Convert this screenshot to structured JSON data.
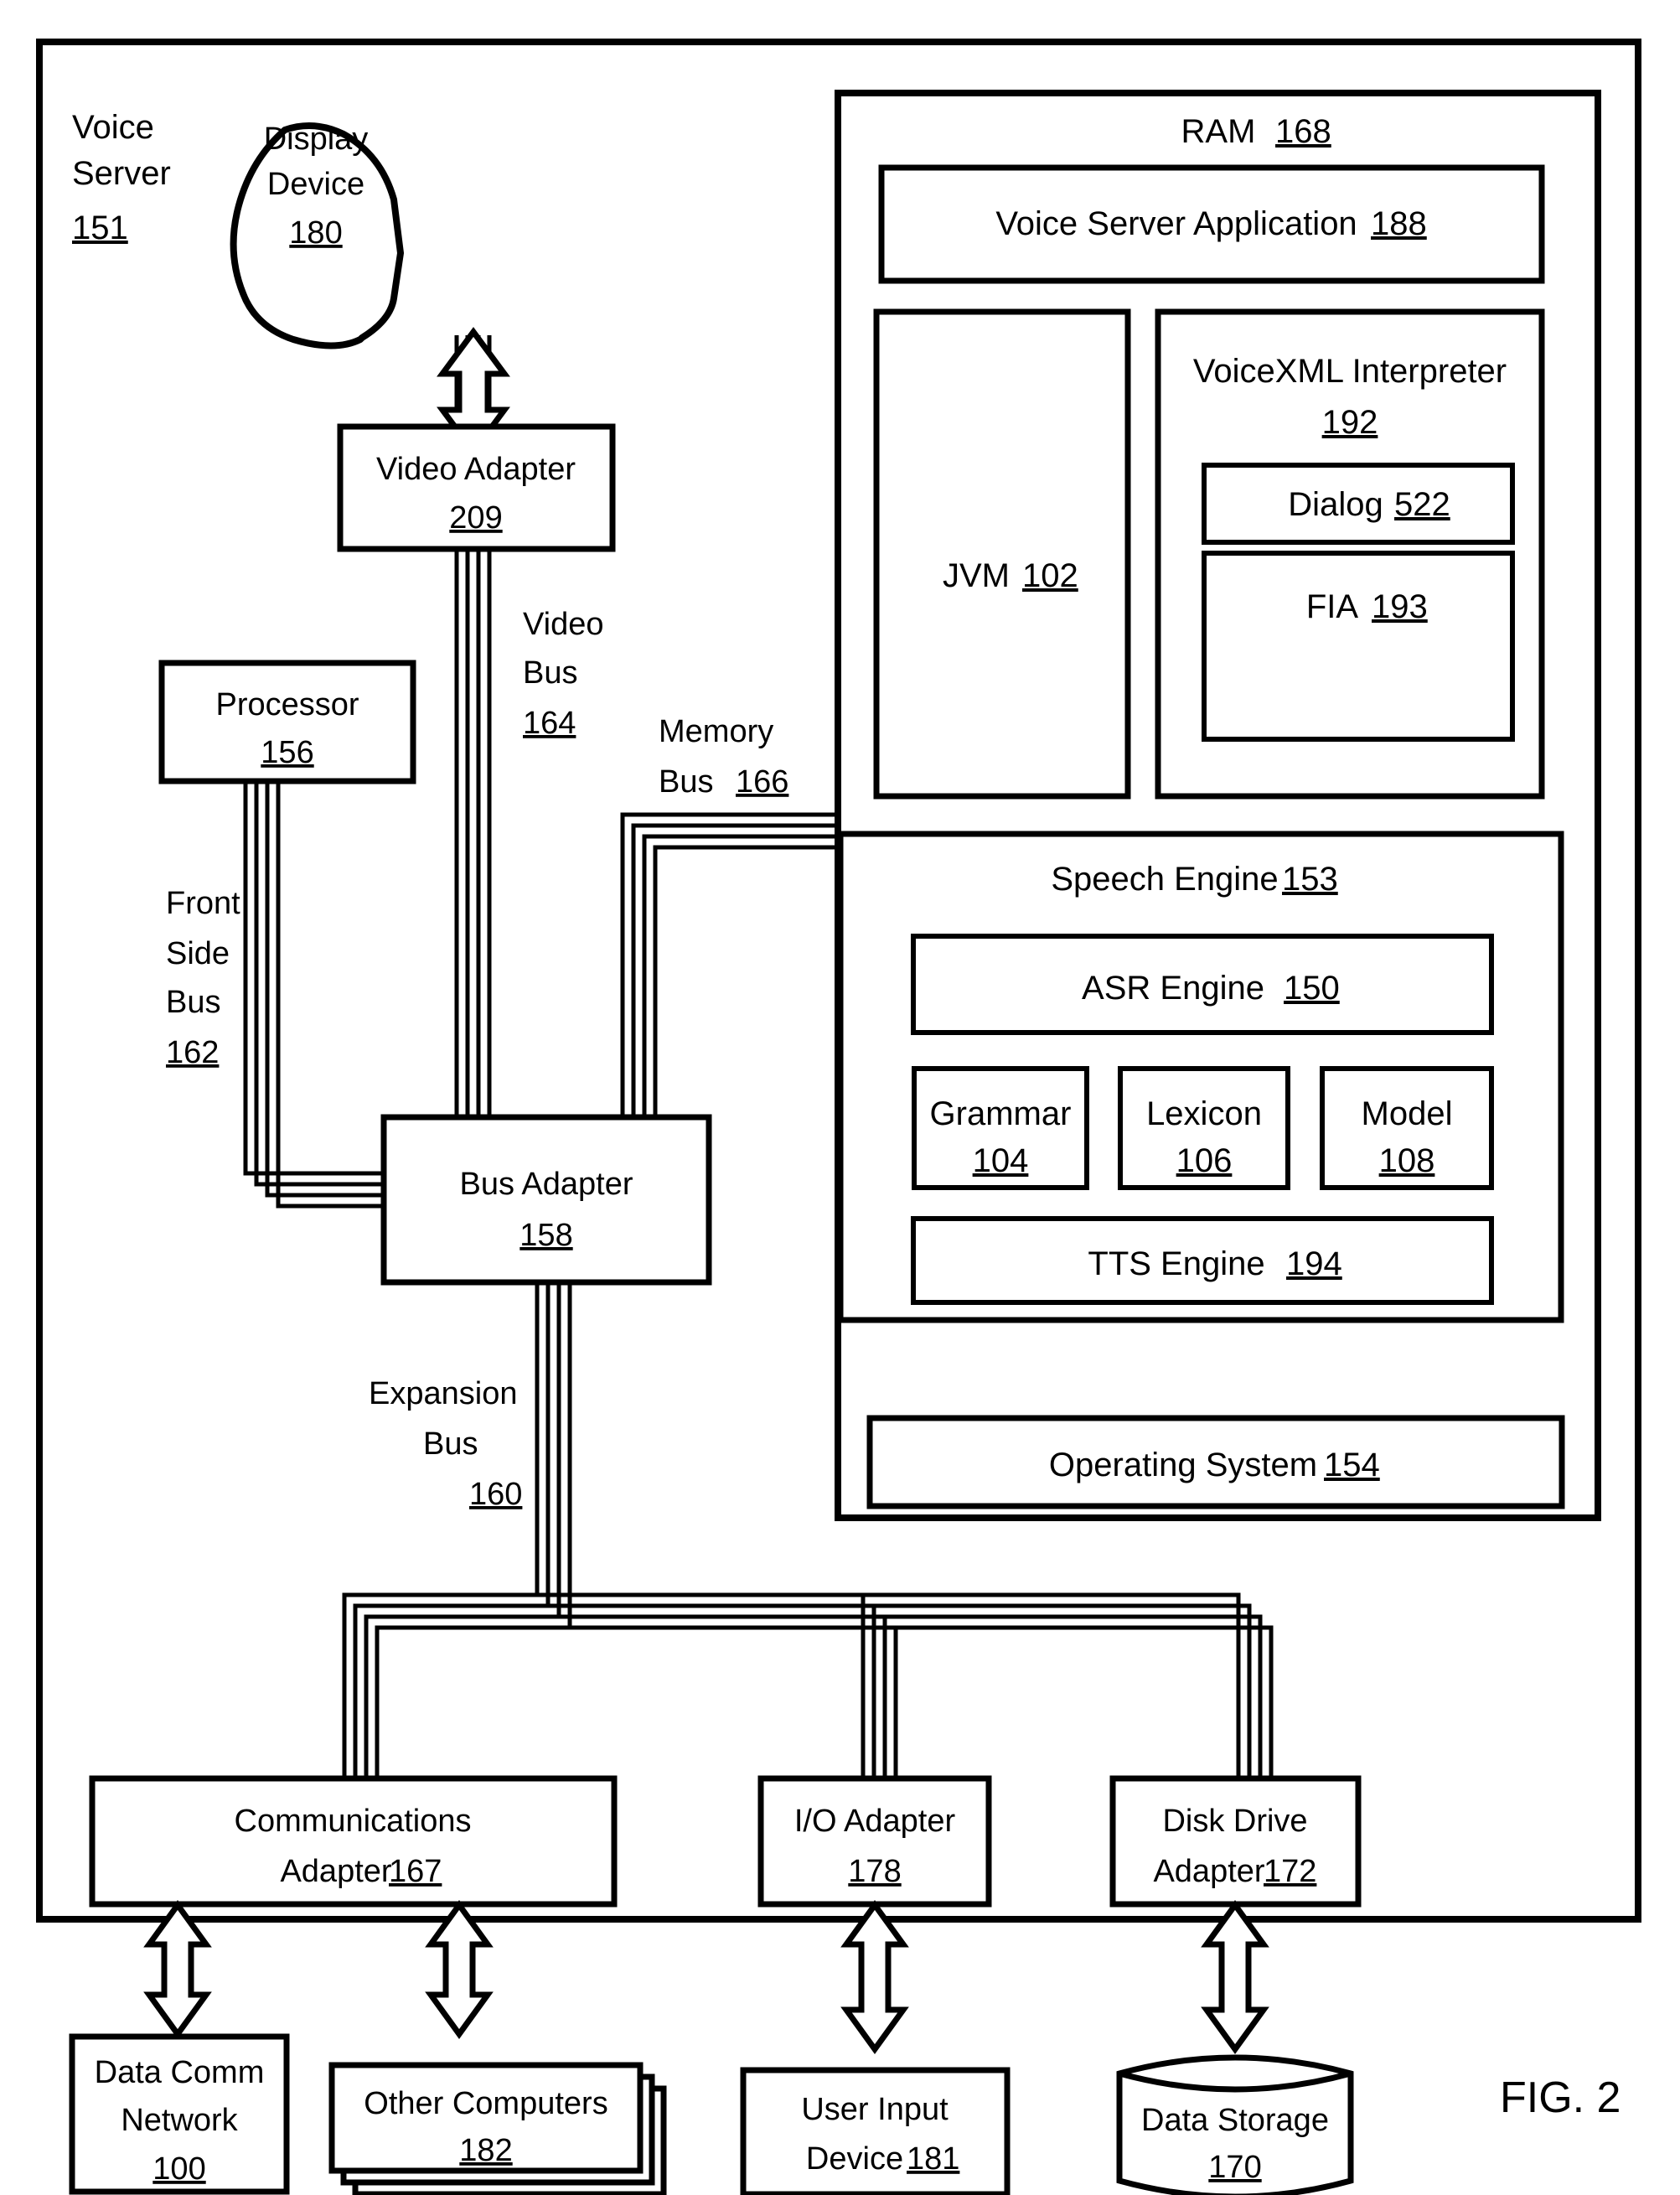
{
  "figure": {
    "label": "FIG. 2"
  },
  "outer": {
    "title_line1": "Voice",
    "title_line2": "Server",
    "title_ref": "151"
  },
  "display_device": {
    "line1": "Display",
    "line2": "Device",
    "ref": "180"
  },
  "video_adapter": {
    "label": "Video Adapter",
    "ref": "209"
  },
  "processor": {
    "label": "Processor",
    "ref": "156"
  },
  "bus_adapter": {
    "label": "Bus Adapter",
    "ref": "158"
  },
  "buses": {
    "video": {
      "l1": "Video",
      "l2": "Bus",
      "ref": "164"
    },
    "memory": {
      "l1": "Memory",
      "l2": "Bus",
      "ref": "166"
    },
    "front_side": {
      "l1": "Front",
      "l2": "Side",
      "l3": "Bus",
      "ref": "162"
    },
    "expansion": {
      "l1": "Expansion",
      "l2": "Bus",
      "ref": "160"
    }
  },
  "ram": {
    "title": "RAM",
    "ref": "168",
    "voice_server_application": {
      "label": "Voice Server Application",
      "ref": "188"
    },
    "jvm": {
      "label": "JVM",
      "ref": "102"
    },
    "voicexml_interpreter": {
      "label": "VoiceXML Interpreter",
      "ref": "192",
      "dialog": {
        "label": "Dialog",
        "ref": "522"
      },
      "fia": {
        "label": "FIA",
        "ref": "193"
      }
    },
    "speech_engine": {
      "label": "Speech Engine",
      "ref": "153",
      "asr_engine": {
        "label": "ASR Engine",
        "ref": "150"
      },
      "grammar": {
        "label": "Grammar",
        "ref": "104"
      },
      "lexicon": {
        "label": "Lexicon",
        "ref": "106"
      },
      "model": {
        "label": "Model",
        "ref": "108"
      },
      "tts_engine": {
        "label": "TTS Engine",
        "ref": "194"
      }
    },
    "operating_system": {
      "label": "Operating System",
      "ref": "154"
    }
  },
  "adapters": {
    "communications": {
      "l1": "Communications",
      "l2": "Adapter",
      "ref": "167"
    },
    "io": {
      "label": "I/O Adapter",
      "ref": "178"
    },
    "disk_drive": {
      "l1": "Disk Drive",
      "l2": "Adapter",
      "ref": "172"
    }
  },
  "peripherals": {
    "data_comm_network": {
      "l1": "Data Comm",
      "l2": "Network",
      "ref": "100"
    },
    "other_computers": {
      "label": "Other Computers",
      "ref": "182"
    },
    "user_input_device": {
      "l1": "User Input",
      "l2": "Device",
      "ref": "181"
    },
    "data_storage": {
      "label": "Data Storage",
      "ref": "170"
    }
  }
}
